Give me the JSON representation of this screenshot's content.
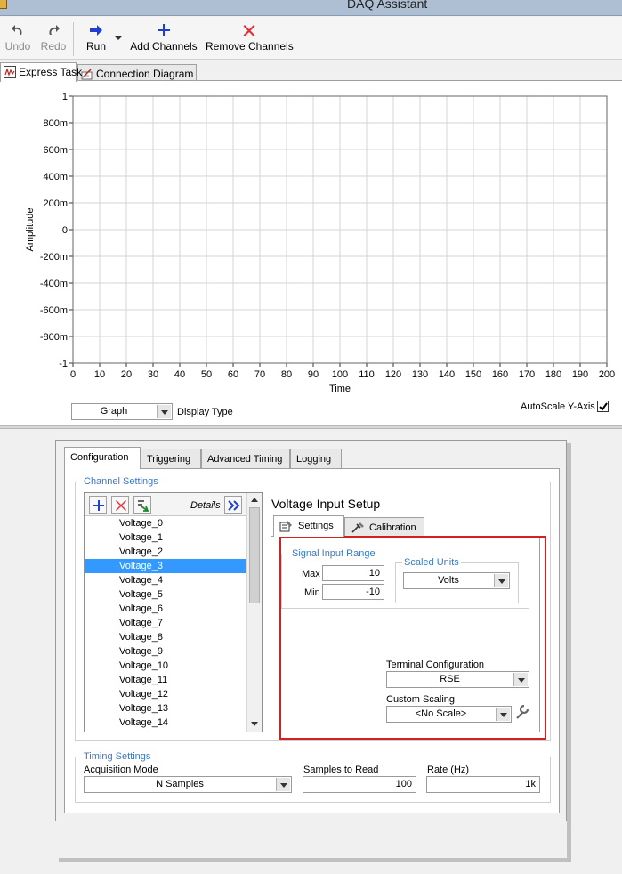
{
  "window": {
    "title": "DAQ Assistant"
  },
  "toolbar": {
    "undo": "Undo",
    "redo": "Redo",
    "run": "Run",
    "add_channels": "Add Channels",
    "remove_channels": "Remove Channels"
  },
  "top_tabs": [
    "Express Task",
    "Connection Diagram"
  ],
  "graph": {
    "y_axis_title": "Amplitude",
    "x_axis_title": "Time",
    "y_ticks": [
      "1",
      "800m",
      "600m",
      "400m",
      "200m",
      "0",
      "-200m",
      "-400m",
      "-600m",
      "-800m",
      "-1"
    ],
    "x_ticks": [
      "0",
      "10",
      "20",
      "30",
      "40",
      "50",
      "60",
      "70",
      "80",
      "90",
      "100",
      "110",
      "120",
      "130",
      "140",
      "150",
      "160",
      "170",
      "180",
      "190",
      "200"
    ],
    "display_type_value": "Graph",
    "display_type_label": "Display Type",
    "autoscale_label": "AutoScale Y-Axis",
    "autoscale_checked": true
  },
  "config": {
    "tabs": [
      "Configuration",
      "Triggering",
      "Advanced Timing",
      "Logging"
    ],
    "channel_settings_label": "Channel Settings",
    "details_label": "Details",
    "channels": [
      "Voltage_0",
      "Voltage_1",
      "Voltage_2",
      "Voltage_3",
      "Voltage_4",
      "Voltage_5",
      "Voltage_6",
      "Voltage_7",
      "Voltage_8",
      "Voltage_9",
      "Voltage_10",
      "Voltage_11",
      "Voltage_12",
      "Voltage_13",
      "Voltage_14"
    ],
    "selected_channel": "Voltage_3",
    "setup_title": "Voltage Input Setup",
    "setup_tabs": [
      "Settings",
      "Calibration"
    ],
    "signal_input_range_label": "Signal Input Range",
    "max_label": "Max",
    "max_value": "10",
    "min_label": "Min",
    "min_value": "-10",
    "scaled_units_label": "Scaled Units",
    "scaled_units_value": "Volts",
    "terminal_config_label": "Terminal Configuration",
    "terminal_config_value": "RSE",
    "custom_scaling_label": "Custom Scaling",
    "custom_scaling_value": "<No Scale>",
    "timing_settings_label": "Timing Settings",
    "acq_mode_label": "Acquisition Mode",
    "acq_mode_value": "N Samples",
    "samples_label": "Samples to Read",
    "samples_value": "100",
    "rate_label": "Rate (Hz)",
    "rate_value": "1k"
  },
  "colors": {
    "accent_blue": "#3399ff",
    "group_label": "#3a78c4",
    "highlight_red": "#d42020"
  }
}
